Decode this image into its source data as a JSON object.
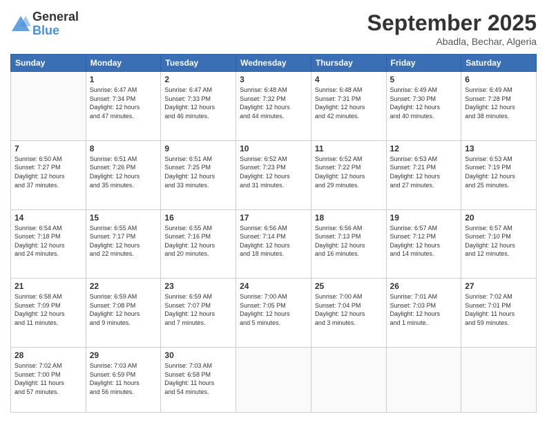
{
  "header": {
    "logo_general": "General",
    "logo_blue": "Blue",
    "month_title": "September 2025",
    "subtitle": "Abadla, Bechar, Algeria"
  },
  "days_of_week": [
    "Sunday",
    "Monday",
    "Tuesday",
    "Wednesday",
    "Thursday",
    "Friday",
    "Saturday"
  ],
  "weeks": [
    [
      {
        "day": "",
        "info": ""
      },
      {
        "day": "1",
        "info": "Sunrise: 6:47 AM\nSunset: 7:34 PM\nDaylight: 12 hours\nand 47 minutes."
      },
      {
        "day": "2",
        "info": "Sunrise: 6:47 AM\nSunset: 7:33 PM\nDaylight: 12 hours\nand 46 minutes."
      },
      {
        "day": "3",
        "info": "Sunrise: 6:48 AM\nSunset: 7:32 PM\nDaylight: 12 hours\nand 44 minutes."
      },
      {
        "day": "4",
        "info": "Sunrise: 6:48 AM\nSunset: 7:31 PM\nDaylight: 12 hours\nand 42 minutes."
      },
      {
        "day": "5",
        "info": "Sunrise: 6:49 AM\nSunset: 7:30 PM\nDaylight: 12 hours\nand 40 minutes."
      },
      {
        "day": "6",
        "info": "Sunrise: 6:49 AM\nSunset: 7:28 PM\nDaylight: 12 hours\nand 38 minutes."
      }
    ],
    [
      {
        "day": "7",
        "info": "Sunrise: 6:50 AM\nSunset: 7:27 PM\nDaylight: 12 hours\nand 37 minutes."
      },
      {
        "day": "8",
        "info": "Sunrise: 6:51 AM\nSunset: 7:26 PM\nDaylight: 12 hours\nand 35 minutes."
      },
      {
        "day": "9",
        "info": "Sunrise: 6:51 AM\nSunset: 7:25 PM\nDaylight: 12 hours\nand 33 minutes."
      },
      {
        "day": "10",
        "info": "Sunrise: 6:52 AM\nSunset: 7:23 PM\nDaylight: 12 hours\nand 31 minutes."
      },
      {
        "day": "11",
        "info": "Sunrise: 6:52 AM\nSunset: 7:22 PM\nDaylight: 12 hours\nand 29 minutes."
      },
      {
        "day": "12",
        "info": "Sunrise: 6:53 AM\nSunset: 7:21 PM\nDaylight: 12 hours\nand 27 minutes."
      },
      {
        "day": "13",
        "info": "Sunrise: 6:53 AM\nSunset: 7:19 PM\nDaylight: 12 hours\nand 25 minutes."
      }
    ],
    [
      {
        "day": "14",
        "info": "Sunrise: 6:54 AM\nSunset: 7:18 PM\nDaylight: 12 hours\nand 24 minutes."
      },
      {
        "day": "15",
        "info": "Sunrise: 6:55 AM\nSunset: 7:17 PM\nDaylight: 12 hours\nand 22 minutes."
      },
      {
        "day": "16",
        "info": "Sunrise: 6:55 AM\nSunset: 7:16 PM\nDaylight: 12 hours\nand 20 minutes."
      },
      {
        "day": "17",
        "info": "Sunrise: 6:56 AM\nSunset: 7:14 PM\nDaylight: 12 hours\nand 18 minutes."
      },
      {
        "day": "18",
        "info": "Sunrise: 6:56 AM\nSunset: 7:13 PM\nDaylight: 12 hours\nand 16 minutes."
      },
      {
        "day": "19",
        "info": "Sunrise: 6:57 AM\nSunset: 7:12 PM\nDaylight: 12 hours\nand 14 minutes."
      },
      {
        "day": "20",
        "info": "Sunrise: 6:57 AM\nSunset: 7:10 PM\nDaylight: 12 hours\nand 12 minutes."
      }
    ],
    [
      {
        "day": "21",
        "info": "Sunrise: 6:58 AM\nSunset: 7:09 PM\nDaylight: 12 hours\nand 11 minutes."
      },
      {
        "day": "22",
        "info": "Sunrise: 6:59 AM\nSunset: 7:08 PM\nDaylight: 12 hours\nand 9 minutes."
      },
      {
        "day": "23",
        "info": "Sunrise: 6:59 AM\nSunset: 7:07 PM\nDaylight: 12 hours\nand 7 minutes."
      },
      {
        "day": "24",
        "info": "Sunrise: 7:00 AM\nSunset: 7:05 PM\nDaylight: 12 hours\nand 5 minutes."
      },
      {
        "day": "25",
        "info": "Sunrise: 7:00 AM\nSunset: 7:04 PM\nDaylight: 12 hours\nand 3 minutes."
      },
      {
        "day": "26",
        "info": "Sunrise: 7:01 AM\nSunset: 7:03 PM\nDaylight: 12 hours\nand 1 minute."
      },
      {
        "day": "27",
        "info": "Sunrise: 7:02 AM\nSunset: 7:01 PM\nDaylight: 11 hours\nand 59 minutes."
      }
    ],
    [
      {
        "day": "28",
        "info": "Sunrise: 7:02 AM\nSunset: 7:00 PM\nDaylight: 11 hours\nand 57 minutes."
      },
      {
        "day": "29",
        "info": "Sunrise: 7:03 AM\nSunset: 6:59 PM\nDaylight: 11 hours\nand 56 minutes."
      },
      {
        "day": "30",
        "info": "Sunrise: 7:03 AM\nSunset: 6:58 PM\nDaylight: 11 hours\nand 54 minutes."
      },
      {
        "day": "",
        "info": ""
      },
      {
        "day": "",
        "info": ""
      },
      {
        "day": "",
        "info": ""
      },
      {
        "day": "",
        "info": ""
      }
    ]
  ]
}
